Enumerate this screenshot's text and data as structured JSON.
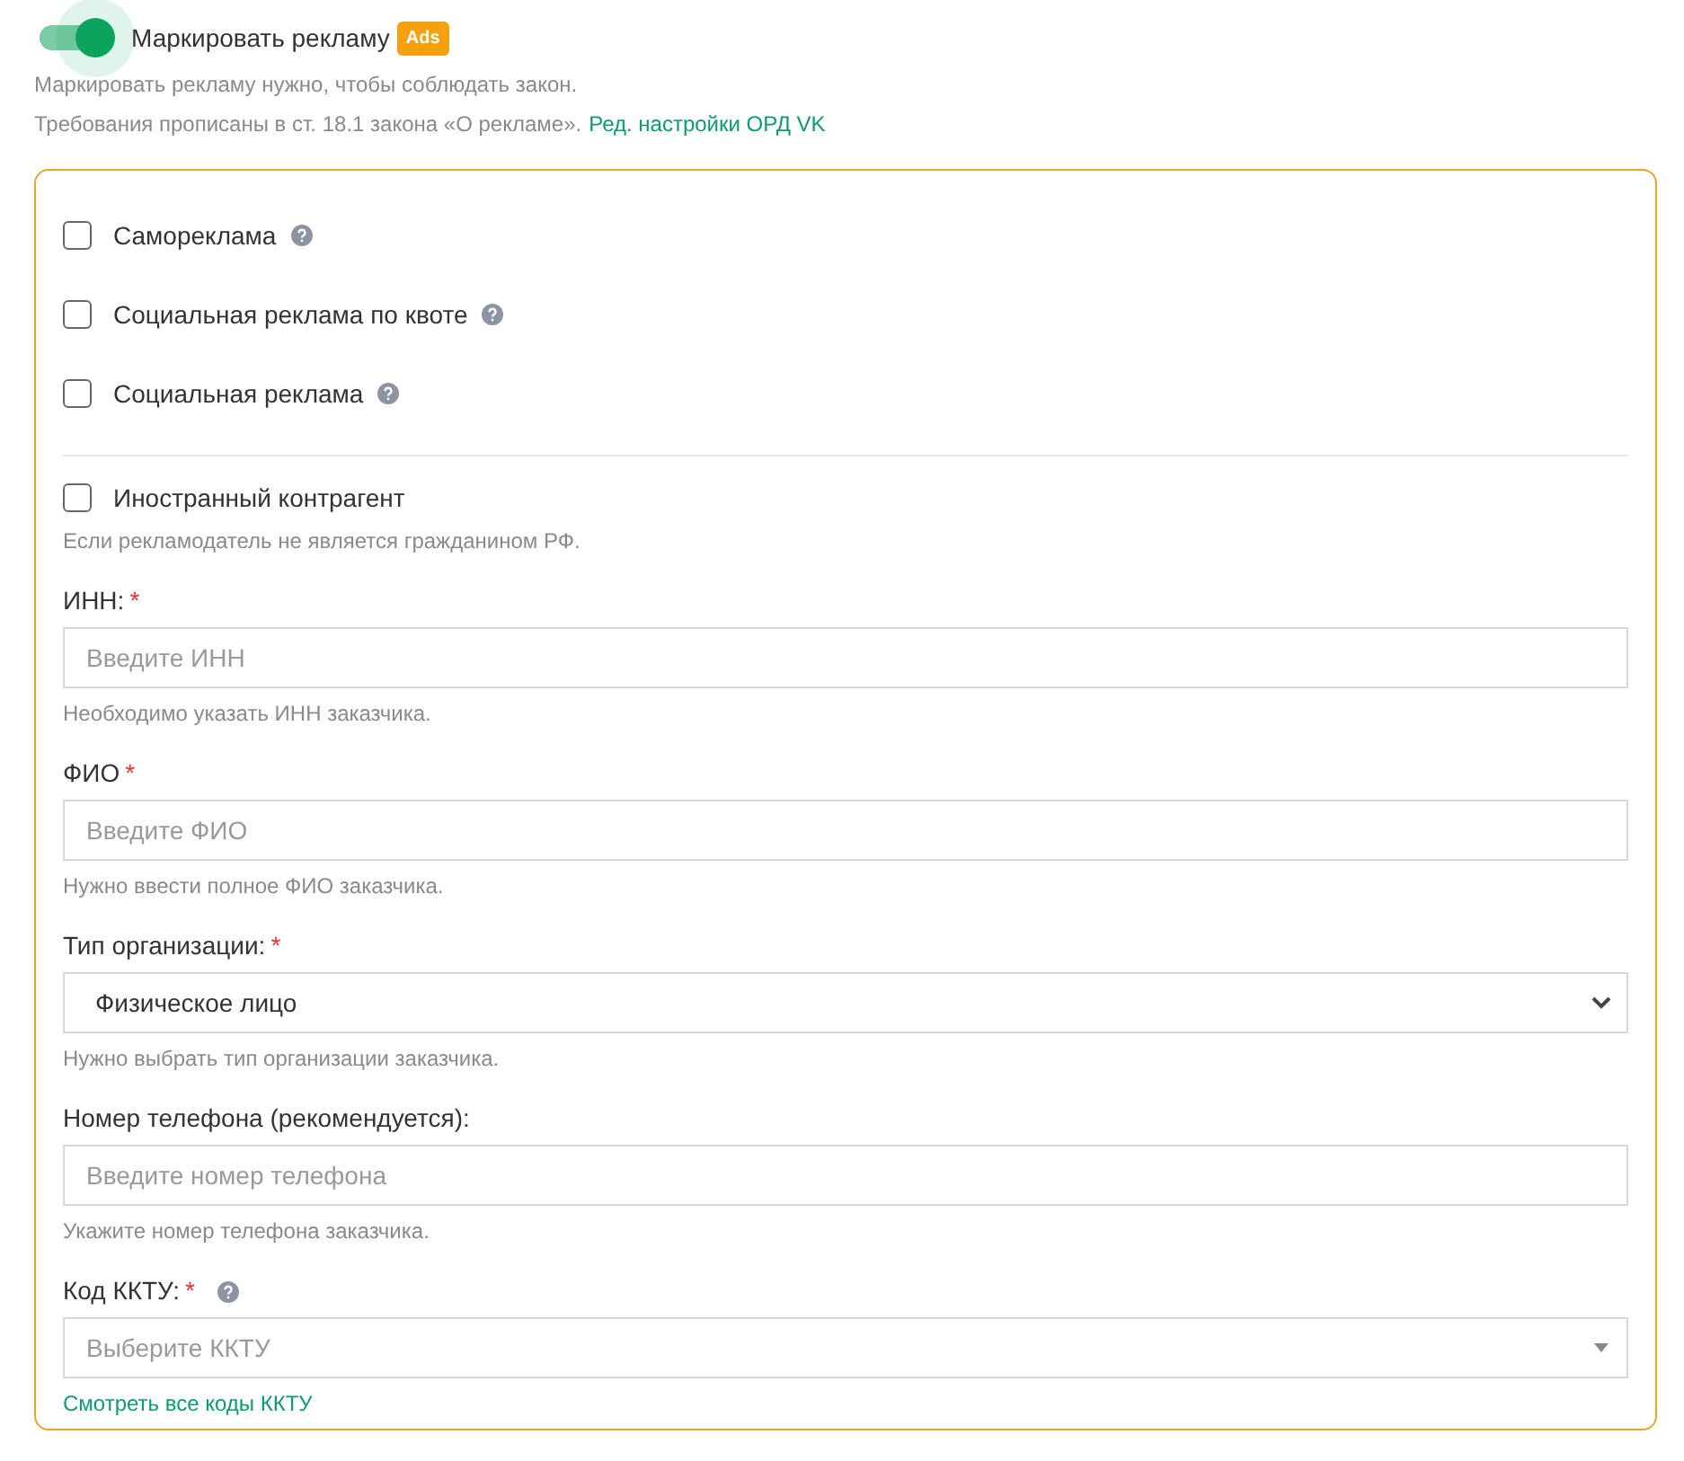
{
  "toggle": {
    "label": "Маркировать рекламу",
    "on": true,
    "badge": "Ads"
  },
  "intro": {
    "line1": "Маркировать рекламу нужно, чтобы соблюдать закон.",
    "line2": "Требования прописаны в ст. 18.1 закона «О рекламе».",
    "link": "Ред. настройки ОРД VK"
  },
  "checkboxes": [
    {
      "label": "Самореклама",
      "checked": false,
      "help": true
    },
    {
      "label": "Социальная реклама по квоте",
      "checked": false,
      "help": true
    },
    {
      "label": "Социальная реклама",
      "checked": false,
      "help": true
    }
  ],
  "foreign": {
    "label": "Иностранный контрагент",
    "checked": false,
    "hint": "Если рекламодатель не является гражданином РФ."
  },
  "fields": [
    {
      "kind": "input",
      "label": "ИНН:",
      "required_mark": "*",
      "placeholder": "Введите ИНН",
      "hint": "Необходимо указать ИНН заказчика."
    },
    {
      "kind": "input",
      "label": "ФИО",
      "required_mark": "*",
      "placeholder": "Введите ФИО",
      "hint": "Нужно ввести полное ФИО заказчика."
    },
    {
      "kind": "select",
      "label": "Тип организации:",
      "required_mark": "*",
      "value": "Физическое лицо",
      "hint": "Нужно выбрать тип организации заказчика."
    },
    {
      "kind": "input",
      "label": "Номер телефона (рекомендуется):",
      "placeholder": "Введите номер телефона",
      "hint": "Укажите номер телефона заказчика."
    },
    {
      "kind": "combo",
      "label": "Код ККТУ:",
      "required_mark": "*",
      "help": true,
      "placeholder": "Выберите ККТУ",
      "link": "Смотреть все коды ККТУ"
    }
  ]
}
